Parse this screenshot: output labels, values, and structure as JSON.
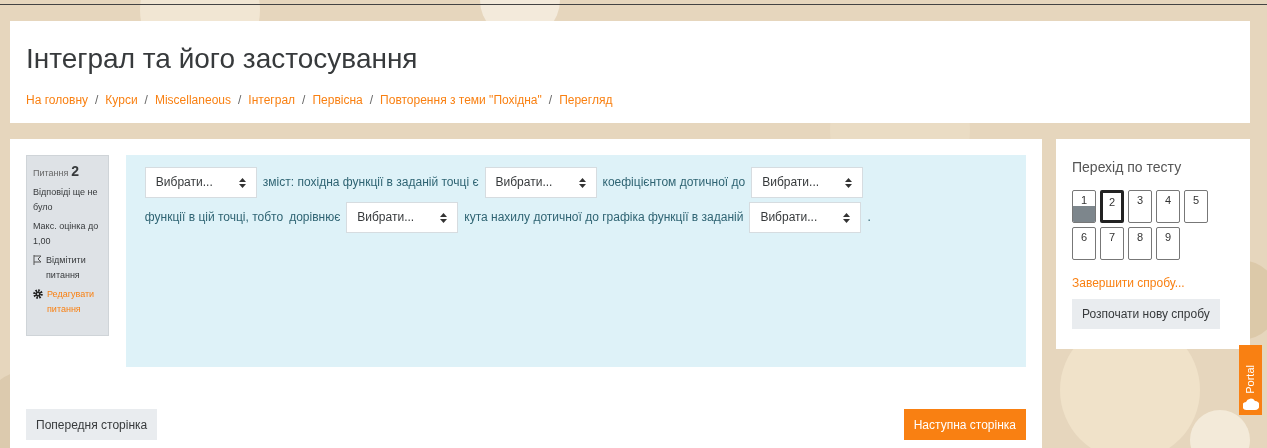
{
  "header": {
    "title": "Інтеграл та його застосування",
    "breadcrumbs": [
      "На головну",
      "Курси",
      "Miscellaneous",
      "Інтеграл",
      "Первісна",
      "Повторення з теми \"Похідна\"",
      "Перегляд"
    ],
    "separator": "/"
  },
  "question_info": {
    "label": "Питання",
    "number": "2",
    "status": "Відповіді ще не було",
    "max_grade": "Макс. оцінка до 1,00",
    "flag": "Відмітити питання",
    "edit": "Редагувати питання"
  },
  "question": {
    "parts": [
      {
        "kind": "select",
        "value": "Вибрати..."
      },
      {
        "kind": "text",
        "text": "зміст: похідна функції в заданій точці є"
      },
      {
        "kind": "select",
        "value": "Вибрати..."
      },
      {
        "kind": "text",
        "text": "коефіцієнтом дотичної до"
      },
      {
        "kind": "select",
        "value": "Вибрати..."
      },
      {
        "kind": "text",
        "text": "функції в цій точці, тобто"
      },
      {
        "kind": "text",
        "text": "дорівнює"
      },
      {
        "kind": "select",
        "value": "Вибрати..."
      },
      {
        "kind": "text",
        "text": "кута нахилу дотичної до графіка функції в заданій"
      },
      {
        "kind": "select",
        "value": "Вибрати..."
      },
      {
        "kind": "text",
        "text": "."
      }
    ]
  },
  "footer": {
    "previous": "Попередня сторінка",
    "next": "Наступна сторінка"
  },
  "quiz_nav": {
    "title": "Перехід по тесту",
    "buttons": [
      {
        "label": "1",
        "answered": true,
        "selected": false
      },
      {
        "label": "2",
        "answered": false,
        "selected": true
      },
      {
        "label": "3",
        "answered": false,
        "selected": false
      },
      {
        "label": "4",
        "answered": false,
        "selected": false
      },
      {
        "label": "5",
        "answered": false,
        "selected": false
      },
      {
        "label": "6",
        "answered": false,
        "selected": false
      },
      {
        "label": "7",
        "answered": false,
        "selected": false
      },
      {
        "label": "8",
        "answered": false,
        "selected": false
      },
      {
        "label": "9",
        "answered": false,
        "selected": false
      }
    ],
    "finish": "Завершити спробу...",
    "restart": "Розпочати нову спробу"
  },
  "portal_tab": {
    "label": "Portal"
  }
}
